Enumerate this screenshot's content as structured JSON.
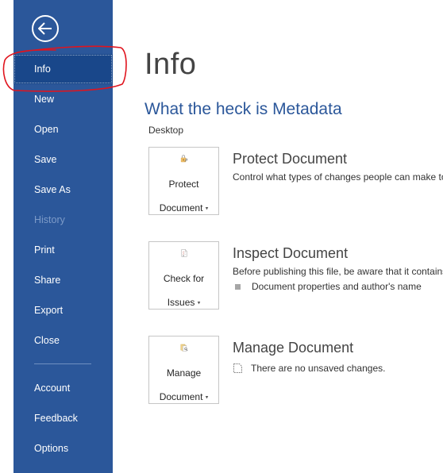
{
  "colors": {
    "sidebar": "#2b579a",
    "selected": "#19478a",
    "accent": "#2b579a",
    "annotation": "#e0141e"
  },
  "sidebar": {
    "back_icon": "back-arrow-icon",
    "items": [
      {
        "label": "Info",
        "state": "selected"
      },
      {
        "label": "New"
      },
      {
        "label": "Open"
      },
      {
        "label": "Save"
      },
      {
        "label": "Save As"
      },
      {
        "label": "History",
        "state": "disabled"
      },
      {
        "label": "Print"
      },
      {
        "label": "Share"
      },
      {
        "label": "Export"
      },
      {
        "label": "Close"
      },
      {
        "label": "Account"
      },
      {
        "label": "Feedback"
      },
      {
        "label": "Options"
      }
    ]
  },
  "main": {
    "title": "Info",
    "doc_title": "What the heck is Metadata",
    "doc_location": "Desktop",
    "sections": [
      {
        "tile_icon": "lock-key-icon",
        "tile_line1": "Protect",
        "tile_line2": "Document",
        "heading": "Protect Document",
        "desc": "Control what types of changes people can make to"
      },
      {
        "tile_icon": "inspect-document-icon",
        "tile_line1": "Check for",
        "tile_line2": "Issues",
        "heading": "Inspect Document",
        "desc": "Before publishing this file, be aware that it contains",
        "bullet": "Document properties and author's name"
      },
      {
        "tile_icon": "manage-document-icon",
        "tile_line1": "Manage",
        "tile_line2": "Document",
        "heading": "Manage Document",
        "note": "There are no unsaved changes."
      }
    ]
  }
}
